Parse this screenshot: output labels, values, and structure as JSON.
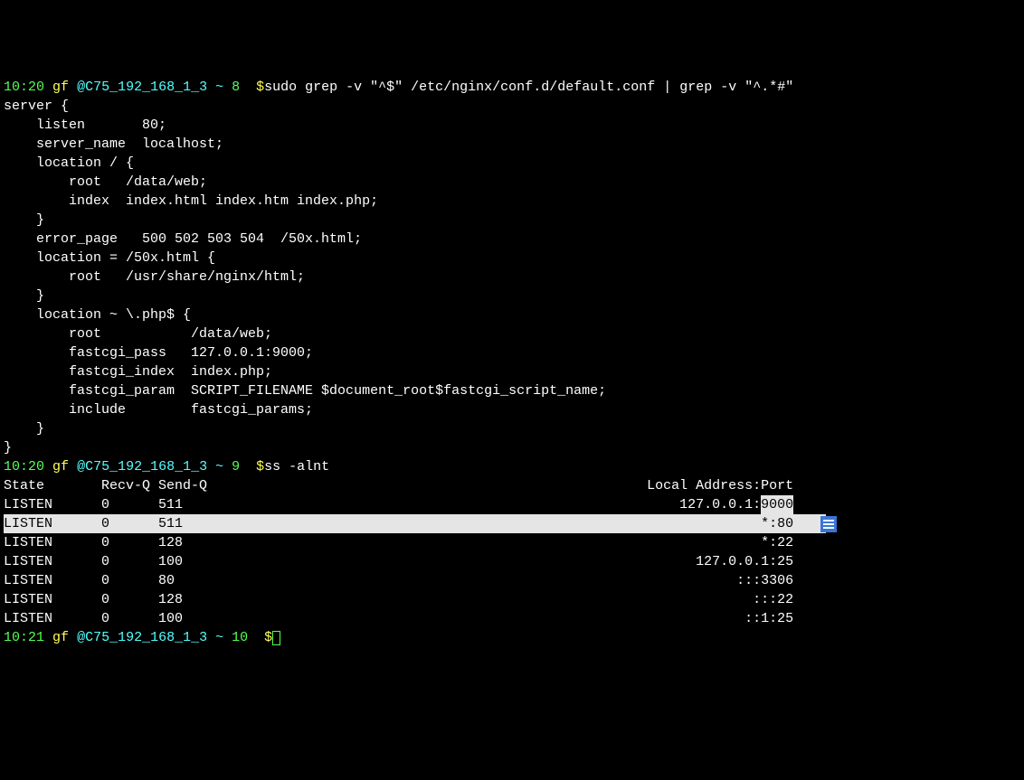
{
  "prompt1": {
    "time": "10:20",
    "user": "gf",
    "host": "@C75_192_168_1_3",
    "path": "~",
    "num": "8",
    "sigil": "$",
    "cmd": "sudo grep -v \"^$\" /etc/nginx/conf.d/default.conf | grep -v \"^.*#\""
  },
  "config_lines": [
    "server {",
    "    listen       80;",
    "    server_name  localhost;",
    "    location / {",
    "        root   /data/web;",
    "        index  index.html index.htm index.php;",
    "    }",
    "    error_page   500 502 503 504  /50x.html;",
    "    location = /50x.html {",
    "        root   /usr/share/nginx/html;",
    "    }",
    "    location ~ \\.php$ {",
    "        root           /data/web;",
    "        fastcgi_pass   127.0.0.1:9000;",
    "        fastcgi_index  index.php;",
    "        fastcgi_param  SCRIPT_FILENAME $document_root$fastcgi_script_name;",
    "        include        fastcgi_params;",
    "    }",
    "}"
  ],
  "prompt2": {
    "time": "10:20",
    "user": "gf",
    "host": "@C75_192_168_1_3",
    "path": "~",
    "num": "9",
    "sigil": "$",
    "cmd": "ss -alnt"
  },
  "ss_header": {
    "state": "State",
    "recvq": "Recv-Q",
    "sendq": "Send-Q",
    "addr": "Local Address:Port"
  },
  "ss_rows": [
    {
      "state": "LISTEN",
      "recvq": "0",
      "sendq": "511",
      "addr": "127.0.0.1:",
      "port": "9000",
      "hl_port": true,
      "hl_row": false
    },
    {
      "state": "LISTEN",
      "recvq": "0",
      "sendq": "511",
      "addr": "*:80",
      "port": "",
      "hl_port": false,
      "hl_row": true
    },
    {
      "state": "LISTEN",
      "recvq": "0",
      "sendq": "128",
      "addr": "*:22",
      "port": "",
      "hl_port": false,
      "hl_row": false
    },
    {
      "state": "LISTEN",
      "recvq": "0",
      "sendq": "100",
      "addr": "127.0.0.1:25",
      "port": "",
      "hl_port": false,
      "hl_row": false
    },
    {
      "state": "LISTEN",
      "recvq": "0",
      "sendq": "80",
      "addr": ":::3306",
      "port": "",
      "hl_port": false,
      "hl_row": false
    },
    {
      "state": "LISTEN",
      "recvq": "0",
      "sendq": "128",
      "addr": ":::22",
      "port": "",
      "hl_port": false,
      "hl_row": false
    },
    {
      "state": "LISTEN",
      "recvq": "0",
      "sendq": "100",
      "addr": "::1:25",
      "port": "",
      "hl_port": false,
      "hl_row": false
    }
  ],
  "prompt3": {
    "time": "10:21",
    "user": "gf",
    "host": "@C75_192_168_1_3",
    "path": "~",
    "num": "10",
    "sigil": "$"
  }
}
